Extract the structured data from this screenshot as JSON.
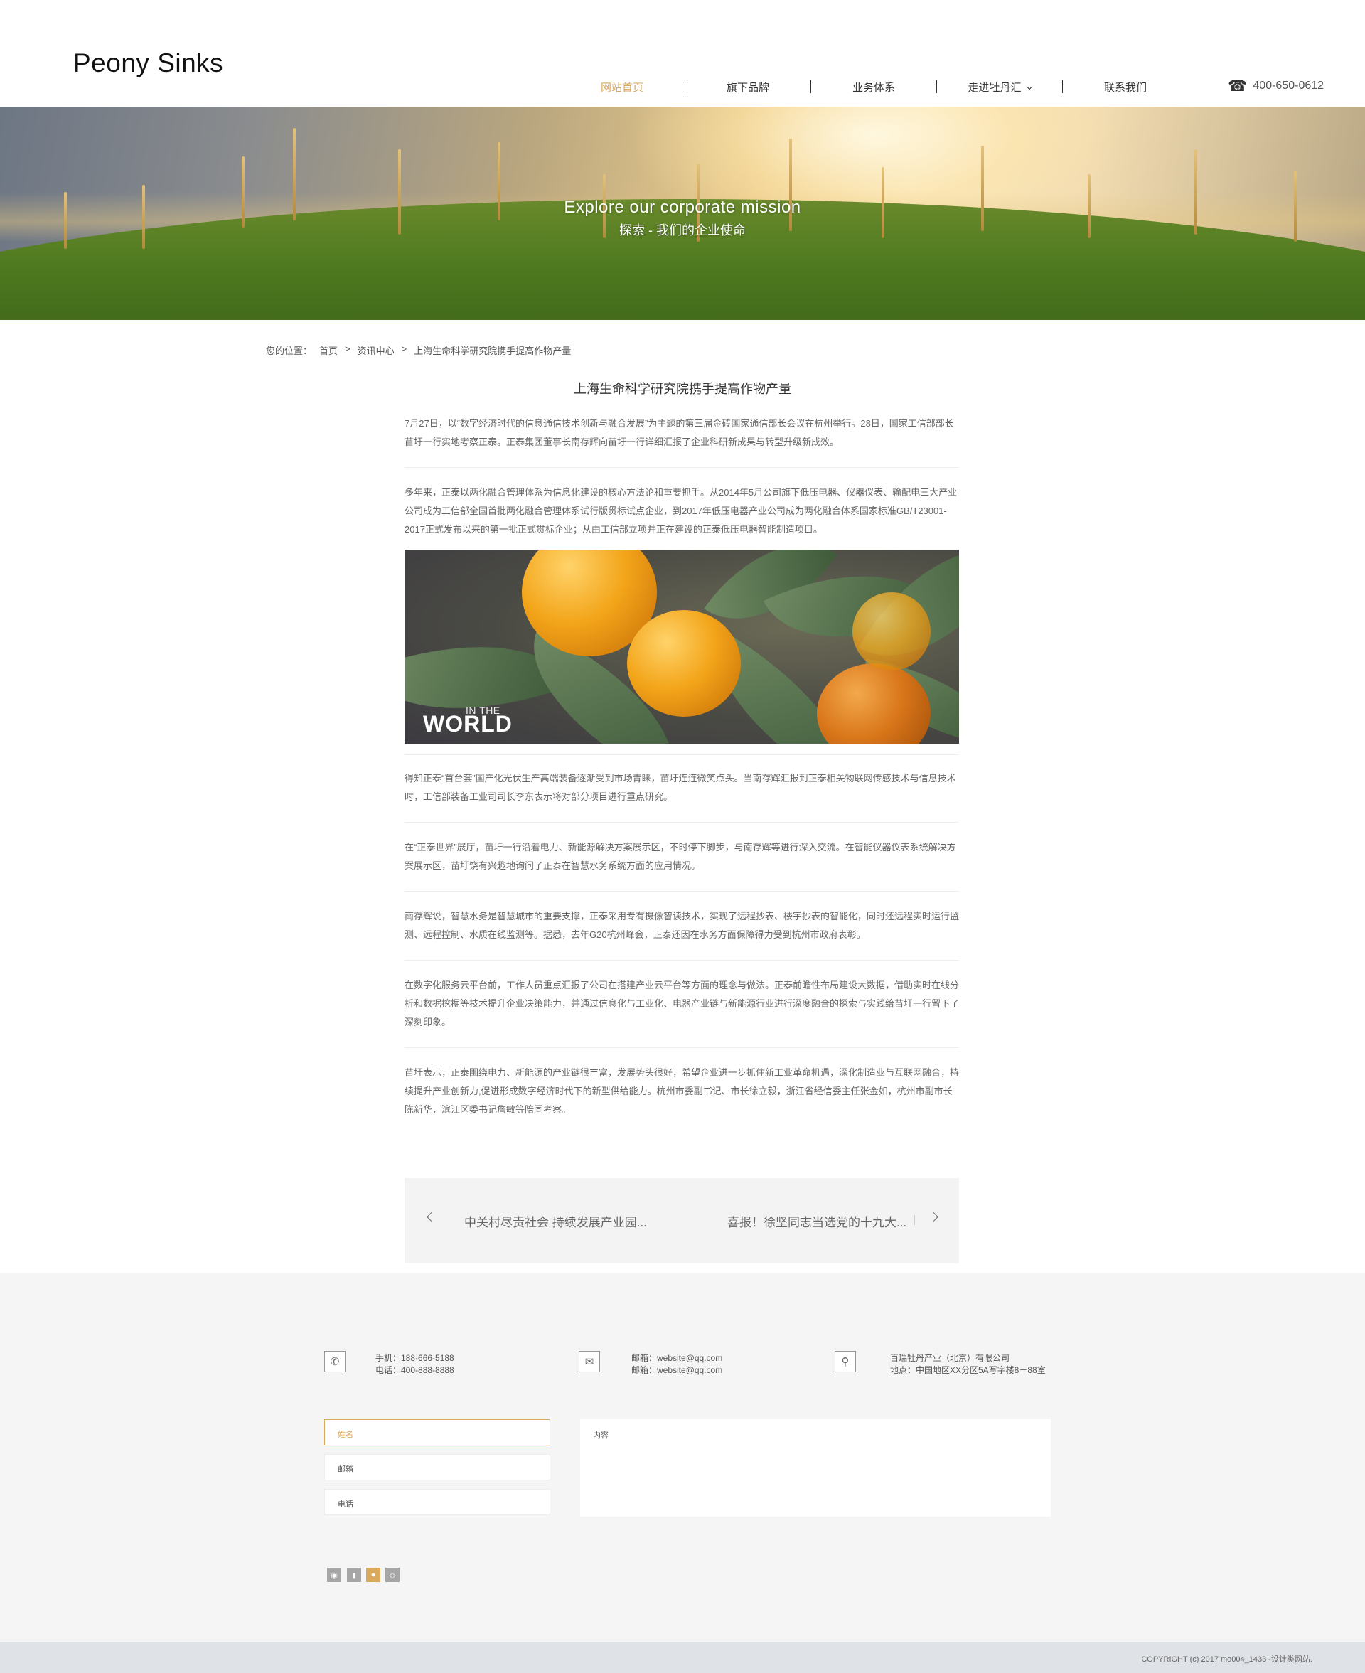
{
  "header": {
    "logo": "Peony Sinks",
    "nav": [
      {
        "label": "网站首页",
        "active": true
      },
      {
        "label": "旗下品牌",
        "active": false
      },
      {
        "label": "业务体系",
        "active": false
      },
      {
        "label": "走进牡丹汇",
        "active": false,
        "dropdown": true
      },
      {
        "label": "联系我们",
        "active": false
      }
    ],
    "phone": "400-650-0612",
    "phone_icon": "telephone-icon"
  },
  "banner": {
    "title": "Explore our corporate mission",
    "subtitle": "探索 - 我们的企业使命"
  },
  "breadcrumb": {
    "prefix": "您的位置：",
    "home": "首页",
    "sep1": ">",
    "section": "资讯中心",
    "sep2": ">",
    "current": "上海生命科学研究院携手提高作物产量"
  },
  "article": {
    "title": "上海生命科学研究院携手提高作物产量",
    "paragraphs": [
      "7月27日，以“数字经济时代的信息通信技术创新与融合发展”为主题的第三届金砖国家通信部长会议在杭州举行。28日，国家工信部部长苗圩一行实地考察正泰。正泰集团董事长南存辉向苗圩一行详细汇报了企业科研新成果与转型升级新成效。",
      "多年来，正泰以两化融合管理体系为信息化建设的核心方法论和重要抓手。从2014年5月公司旗下低压电器、仪器仪表、输配电三大产业公司成为工信部全国首批两化融合管理体系试行版贯标试点企业，到2017年低压电器产业公司成为两化融合体系国家标准GB/T23001-2017正式发布以来的第一批正式贯标企业；从由工信部立项并正在建设的正泰低压电器智能制造项目。",
      "得知正泰“首台套”国产化光伏生产高端装备逐渐受到市场青睐，苗圩连连微笑点头。当南存辉汇报到正泰相关物联网传感技术与信息技术时，工信部装备工业司司长李东表示将对部分项目进行重点研究。",
      "在“正泰世界”展厅，苗圩一行沿着电力、新能源解决方案展示区，不时停下脚步，与南存辉等进行深入交流。在智能仪器仪表系统解决方案展示区，苗圩饶有兴趣地询问了正泰在智慧水务系统方面的应用情况。",
      "南存辉说，智慧水务是智慧城市的重要支撑，正泰采用专有摄像智读技术，实现了远程抄表、楼宇抄表的智能化，同时还远程实时运行监测、远程控制、水质在线监测等。据悉，去年G20杭州峰会，正泰还因在水务方面保障得力受到杭州市政府表彰。",
      "在数字化服务云平台前，工作人员重点汇报了公司在搭建产业云平台等方面的理念与做法。正泰前瞻性布局建设大数据，借助实时在线分析和数据挖掘等技术提升企业决策能力，并通过信息化与工业化、电器产业链与新能源行业进行深度融合的探索与实践给苗圩一行留下了深刻印象。",
      "苗圩表示，正泰围绕电力、新能源的产业链很丰富，发展势头很好，希望企业进一步抓住新工业革命机遇，深化制造业与互联网融合，持续提升产业创新力,促进形成数字经济时代下的新型供给能力。杭州市委副书记、市长徐立毅，浙江省经信委主任张金如，杭州市副市长陈新华，滨江区委书记詹敏等陪同考察。"
    ],
    "image": {
      "caption_small": "IN THE",
      "caption_big": "WORLD"
    }
  },
  "postnav": {
    "prev": "中关村尽责社会 持续发展产业园...",
    "next": "喜报！徐坚同志当选党的十九大..."
  },
  "footer": {
    "contacts": [
      {
        "icon": "phone-icon",
        "line1": "手机：188-666-5188",
        "line2": "电话：400-888-8888"
      },
      {
        "icon": "mail-icon",
        "line1": "邮箱：website@qq.com",
        "line2": "邮箱：website@qq.com"
      },
      {
        "icon": "location-pin-icon",
        "line1": "百瑞牡丹产业（北京）有限公司",
        "line2": "地点：中国地区XX分区5A写字楼8－88室"
      }
    ],
    "form": {
      "name": "姓名",
      "email": "邮箱",
      "phone": "电话",
      "content": "内容"
    },
    "social": [
      "weibo-icon",
      "qq-icon",
      "wechat-icon",
      "renren-icon"
    ],
    "copyright": "COPYRIGHT (c) 2017 mo004_1433 -设计类网站."
  },
  "colors": {
    "accent": "#d9a95e",
    "footer_bg": "#f5f5f5",
    "copyright_bg": "#dfe2e7"
  }
}
